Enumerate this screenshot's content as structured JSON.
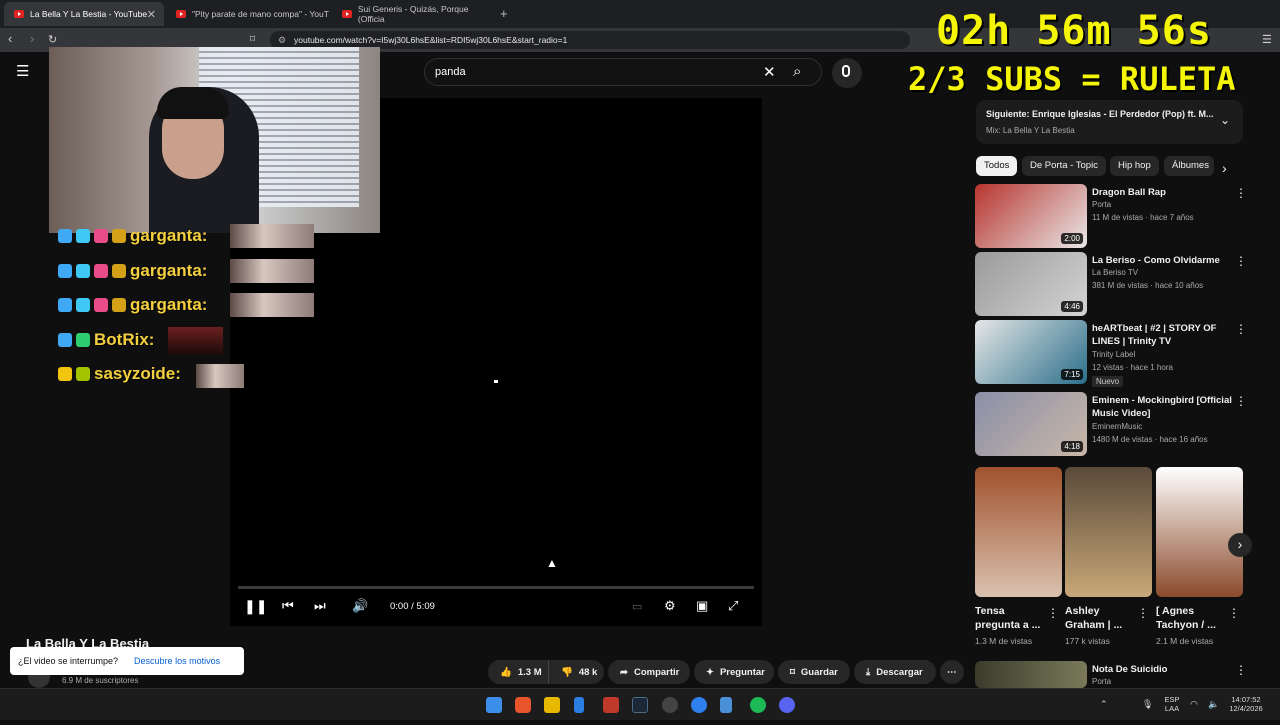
{
  "browser": {
    "tabs": [
      {
        "label": "La Bella Y La Bestia - YouTube",
        "active": true
      },
      {
        "label": "\"Pity parate de mano compa\" - YouT"
      },
      {
        "label": "Sui Generis - Quizás, Porque (Officia"
      }
    ],
    "new_tab": "+",
    "url": "youtube.com/watch?v=I5wj30L6hsE&list=RDI5wj30L6hsE&start_radio=1"
  },
  "search": {
    "query": "panda"
  },
  "overlay": {
    "timer": "02h 56m 56s",
    "subs_goal": "2/3 SUBS = RULETA"
  },
  "chat": [
    {
      "user": "garganta:",
      "colors": [
        "#3fa9f5",
        "#3fc8f5",
        "#e84d8a",
        "#d4a017"
      ]
    },
    {
      "user": "garganta:",
      "colors": [
        "#3fa9f5",
        "#3fc8f5",
        "#e84d8a",
        "#d4a017"
      ]
    },
    {
      "user": "garganta:",
      "colors": [
        "#3fa9f5",
        "#3fc8f5",
        "#e84d8a",
        "#d4a017"
      ]
    },
    {
      "user": "BotRix:",
      "colors": [
        "#3fa9f5",
        "#2ecc71"
      ]
    },
    {
      "user": "sasyzoide:",
      "colors": [
        "#f1c40f",
        "#a3c200"
      ]
    }
  ],
  "player": {
    "time": "0:00 / 5:09",
    "progress": 0
  },
  "video": {
    "title": "La Bella Y La Bestia",
    "subs": "6.9 M de suscriptores",
    "likes": "1.3 M",
    "dislikes": "48 k",
    "share": "Compartir",
    "ask": "Preguntar",
    "save": "Guardar",
    "download": "Descargar"
  },
  "toast": {
    "text": "¿El video se interrumpe?",
    "link": "Descubre los motivos"
  },
  "next": {
    "label": "Siguiente: Enrique Iglesias - El Perdedor (Pop) ft. M...",
    "mix": "Mix: La Bella Y La Bestia"
  },
  "chips": [
    "Todos",
    "De Porta - Topic",
    "Hip hop",
    "Álbumes"
  ],
  "videos": [
    {
      "title": "Dragon Ball Rap",
      "channel": "Porta",
      "meta": "11 M de vistas · hace 7 años",
      "duration": "2:00",
      "thumb": [
        "#b8342e",
        "#e8e8e8"
      ]
    },
    {
      "title": "La Beriso - Como Olvidarme",
      "channel": "La Beriso TV",
      "meta": "381 M de vistas · hace 10 años",
      "duration": "4:46",
      "thumb": [
        "#9a9a9a",
        "#d4d4d4"
      ]
    },
    {
      "title": "heARTbeat | #2 | STORY OF LINES | Trinity TV",
      "channel": "Trinity Label",
      "meta": "12 vistas · hace 1 hora",
      "duration": "7:15",
      "badge": "Nuevo",
      "thumb": [
        "#e6e6e6",
        "#2a6f8a"
      ]
    },
    {
      "title": "Eminem - Mockingbird [Official Music Video]",
      "channel": "EminemMusic",
      "meta": "1480 M de vistas · hace 16 años",
      "duration": "4:18",
      "thumb": [
        "#8a8fa8",
        "#c9b7a8"
      ]
    }
  ],
  "shorts": [
    {
      "title": "Tensa pregunta a ...",
      "views": "1.3 M de vistas",
      "thumb": [
        "#a0522d",
        "#d9c2b0"
      ]
    },
    {
      "title": "Ashley Graham | ...",
      "views": "177 k vistas",
      "thumb": [
        "#5a4a3a",
        "#c8a878"
      ]
    },
    {
      "title": "[ Agnes Tachyon / ...",
      "views": "2.1 M de vistas",
      "thumb": [
        "#ffffff",
        "#8b4a2b"
      ]
    }
  ],
  "extra_video": {
    "title": "Nota De Suicidio",
    "channel": "Porta"
  },
  "taskbar": {
    "lang1": "ESP",
    "lang2": "LAA",
    "time": "14:07:52",
    "date": "12/4/2026"
  },
  "colors": {
    "accent": "#f5f507",
    "yt_red": "#ff0000",
    "link": "#065fd4"
  }
}
